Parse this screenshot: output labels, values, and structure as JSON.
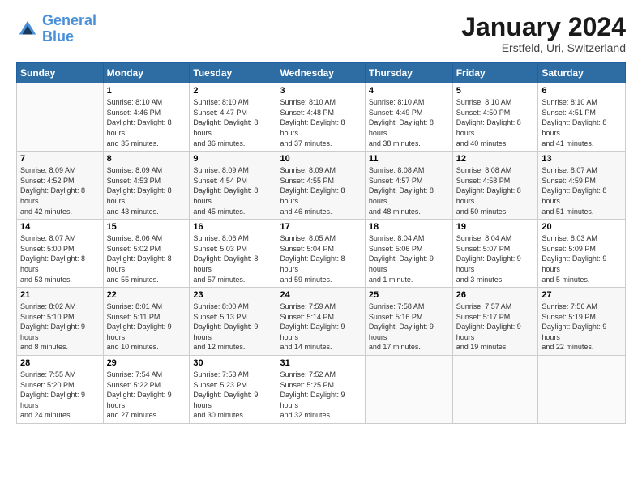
{
  "logo": {
    "line1": "General",
    "line2": "Blue"
  },
  "title": "January 2024",
  "subtitle": "Erstfeld, Uri, Switzerland",
  "weekdays": [
    "Sunday",
    "Monday",
    "Tuesday",
    "Wednesday",
    "Thursday",
    "Friday",
    "Saturday"
  ],
  "weeks": [
    [
      {
        "day": "",
        "sunrise": "",
        "sunset": "",
        "daylight": ""
      },
      {
        "day": "1",
        "sunrise": "Sunrise: 8:10 AM",
        "sunset": "Sunset: 4:46 PM",
        "daylight": "Daylight: 8 hours and 35 minutes."
      },
      {
        "day": "2",
        "sunrise": "Sunrise: 8:10 AM",
        "sunset": "Sunset: 4:47 PM",
        "daylight": "Daylight: 8 hours and 36 minutes."
      },
      {
        "day": "3",
        "sunrise": "Sunrise: 8:10 AM",
        "sunset": "Sunset: 4:48 PM",
        "daylight": "Daylight: 8 hours and 37 minutes."
      },
      {
        "day": "4",
        "sunrise": "Sunrise: 8:10 AM",
        "sunset": "Sunset: 4:49 PM",
        "daylight": "Daylight: 8 hours and 38 minutes."
      },
      {
        "day": "5",
        "sunrise": "Sunrise: 8:10 AM",
        "sunset": "Sunset: 4:50 PM",
        "daylight": "Daylight: 8 hours and 40 minutes."
      },
      {
        "day": "6",
        "sunrise": "Sunrise: 8:10 AM",
        "sunset": "Sunset: 4:51 PM",
        "daylight": "Daylight: 8 hours and 41 minutes."
      }
    ],
    [
      {
        "day": "7",
        "sunrise": "Sunrise: 8:09 AM",
        "sunset": "Sunset: 4:52 PM",
        "daylight": "Daylight: 8 hours and 42 minutes."
      },
      {
        "day": "8",
        "sunrise": "Sunrise: 8:09 AM",
        "sunset": "Sunset: 4:53 PM",
        "daylight": "Daylight: 8 hours and 43 minutes."
      },
      {
        "day": "9",
        "sunrise": "Sunrise: 8:09 AM",
        "sunset": "Sunset: 4:54 PM",
        "daylight": "Daylight: 8 hours and 45 minutes."
      },
      {
        "day": "10",
        "sunrise": "Sunrise: 8:09 AM",
        "sunset": "Sunset: 4:55 PM",
        "daylight": "Daylight: 8 hours and 46 minutes."
      },
      {
        "day": "11",
        "sunrise": "Sunrise: 8:08 AM",
        "sunset": "Sunset: 4:57 PM",
        "daylight": "Daylight: 8 hours and 48 minutes."
      },
      {
        "day": "12",
        "sunrise": "Sunrise: 8:08 AM",
        "sunset": "Sunset: 4:58 PM",
        "daylight": "Daylight: 8 hours and 50 minutes."
      },
      {
        "day": "13",
        "sunrise": "Sunrise: 8:07 AM",
        "sunset": "Sunset: 4:59 PM",
        "daylight": "Daylight: 8 hours and 51 minutes."
      }
    ],
    [
      {
        "day": "14",
        "sunrise": "Sunrise: 8:07 AM",
        "sunset": "Sunset: 5:00 PM",
        "daylight": "Daylight: 8 hours and 53 minutes."
      },
      {
        "day": "15",
        "sunrise": "Sunrise: 8:06 AM",
        "sunset": "Sunset: 5:02 PM",
        "daylight": "Daylight: 8 hours and 55 minutes."
      },
      {
        "day": "16",
        "sunrise": "Sunrise: 8:06 AM",
        "sunset": "Sunset: 5:03 PM",
        "daylight": "Daylight: 8 hours and 57 minutes."
      },
      {
        "day": "17",
        "sunrise": "Sunrise: 8:05 AM",
        "sunset": "Sunset: 5:04 PM",
        "daylight": "Daylight: 8 hours and 59 minutes."
      },
      {
        "day": "18",
        "sunrise": "Sunrise: 8:04 AM",
        "sunset": "Sunset: 5:06 PM",
        "daylight": "Daylight: 9 hours and 1 minute."
      },
      {
        "day": "19",
        "sunrise": "Sunrise: 8:04 AM",
        "sunset": "Sunset: 5:07 PM",
        "daylight": "Daylight: 9 hours and 3 minutes."
      },
      {
        "day": "20",
        "sunrise": "Sunrise: 8:03 AM",
        "sunset": "Sunset: 5:09 PM",
        "daylight": "Daylight: 9 hours and 5 minutes."
      }
    ],
    [
      {
        "day": "21",
        "sunrise": "Sunrise: 8:02 AM",
        "sunset": "Sunset: 5:10 PM",
        "daylight": "Daylight: 9 hours and 8 minutes."
      },
      {
        "day": "22",
        "sunrise": "Sunrise: 8:01 AM",
        "sunset": "Sunset: 5:11 PM",
        "daylight": "Daylight: 9 hours and 10 minutes."
      },
      {
        "day": "23",
        "sunrise": "Sunrise: 8:00 AM",
        "sunset": "Sunset: 5:13 PM",
        "daylight": "Daylight: 9 hours and 12 minutes."
      },
      {
        "day": "24",
        "sunrise": "Sunrise: 7:59 AM",
        "sunset": "Sunset: 5:14 PM",
        "daylight": "Daylight: 9 hours and 14 minutes."
      },
      {
        "day": "25",
        "sunrise": "Sunrise: 7:58 AM",
        "sunset": "Sunset: 5:16 PM",
        "daylight": "Daylight: 9 hours and 17 minutes."
      },
      {
        "day": "26",
        "sunrise": "Sunrise: 7:57 AM",
        "sunset": "Sunset: 5:17 PM",
        "daylight": "Daylight: 9 hours and 19 minutes."
      },
      {
        "day": "27",
        "sunrise": "Sunrise: 7:56 AM",
        "sunset": "Sunset: 5:19 PM",
        "daylight": "Daylight: 9 hours and 22 minutes."
      }
    ],
    [
      {
        "day": "28",
        "sunrise": "Sunrise: 7:55 AM",
        "sunset": "Sunset: 5:20 PM",
        "daylight": "Daylight: 9 hours and 24 minutes."
      },
      {
        "day": "29",
        "sunrise": "Sunrise: 7:54 AM",
        "sunset": "Sunset: 5:22 PM",
        "daylight": "Daylight: 9 hours and 27 minutes."
      },
      {
        "day": "30",
        "sunrise": "Sunrise: 7:53 AM",
        "sunset": "Sunset: 5:23 PM",
        "daylight": "Daylight: 9 hours and 30 minutes."
      },
      {
        "day": "31",
        "sunrise": "Sunrise: 7:52 AM",
        "sunset": "Sunset: 5:25 PM",
        "daylight": "Daylight: 9 hours and 32 minutes."
      },
      {
        "day": "",
        "sunrise": "",
        "sunset": "",
        "daylight": ""
      },
      {
        "day": "",
        "sunrise": "",
        "sunset": "",
        "daylight": ""
      },
      {
        "day": "",
        "sunrise": "",
        "sunset": "",
        "daylight": ""
      }
    ]
  ]
}
